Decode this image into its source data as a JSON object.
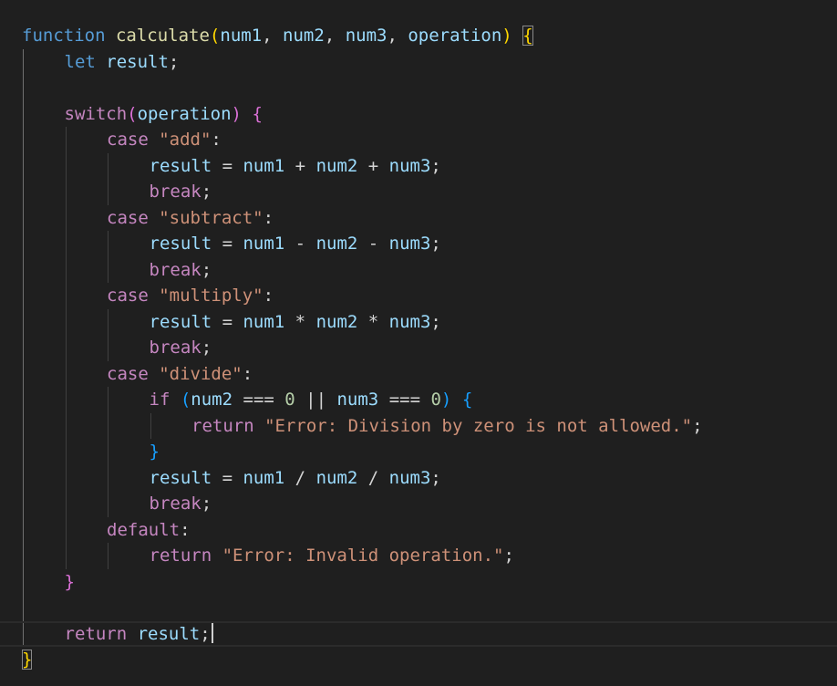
{
  "editor": {
    "language": "javascript",
    "current_line": 24,
    "colors": {
      "background": "#1f1f1f",
      "keyword_storage": "#569cd6",
      "keyword_control": "#c586c0",
      "function_name": "#dcdcaa",
      "variable": "#9cdcfe",
      "string": "#ce9178",
      "number": "#b5cea8",
      "punctuation": "#d4d4d4",
      "bracket_gold": "#ffd700",
      "bracket_pink": "#da70d6",
      "bracket_blue": "#179fff"
    },
    "lines": [
      {
        "indent": 0,
        "tokens": [
          {
            "t": "function",
            "c": "keyword_storage"
          },
          {
            "t": " ",
            "c": "punctuation"
          },
          {
            "t": "calculate",
            "c": "function_name"
          },
          {
            "t": "(",
            "c": "bracket_gold"
          },
          {
            "t": "num1",
            "c": "variable"
          },
          {
            "t": ", ",
            "c": "punctuation"
          },
          {
            "t": "num2",
            "c": "variable"
          },
          {
            "t": ", ",
            "c": "punctuation"
          },
          {
            "t": "num3",
            "c": "variable"
          },
          {
            "t": ", ",
            "c": "punctuation"
          },
          {
            "t": "operation",
            "c": "variable"
          },
          {
            "t": ")",
            "c": "bracket_gold"
          },
          {
            "t": " ",
            "c": "punctuation"
          },
          {
            "t": "{",
            "c": "bracket_gold",
            "match": true
          }
        ]
      },
      {
        "indent": 1,
        "tokens": [
          {
            "t": "let",
            "c": "keyword_storage"
          },
          {
            "t": " ",
            "c": "punctuation"
          },
          {
            "t": "result",
            "c": "variable"
          },
          {
            "t": ";",
            "c": "punctuation"
          }
        ]
      },
      {
        "indent": 0,
        "tokens": []
      },
      {
        "indent": 1,
        "tokens": [
          {
            "t": "switch",
            "c": "keyword_control"
          },
          {
            "t": "(",
            "c": "bracket_pink"
          },
          {
            "t": "operation",
            "c": "variable"
          },
          {
            "t": ")",
            "c": "bracket_pink"
          },
          {
            "t": " ",
            "c": "punctuation"
          },
          {
            "t": "{",
            "c": "bracket_pink"
          }
        ]
      },
      {
        "indent": 2,
        "tokens": [
          {
            "t": "case",
            "c": "keyword_control"
          },
          {
            "t": " ",
            "c": "punctuation"
          },
          {
            "t": "\"add\"",
            "c": "string"
          },
          {
            "t": ":",
            "c": "punctuation"
          }
        ]
      },
      {
        "indent": 3,
        "tokens": [
          {
            "t": "result",
            "c": "variable"
          },
          {
            "t": " = ",
            "c": "punctuation"
          },
          {
            "t": "num1",
            "c": "variable"
          },
          {
            "t": " + ",
            "c": "punctuation"
          },
          {
            "t": "num2",
            "c": "variable"
          },
          {
            "t": " + ",
            "c": "punctuation"
          },
          {
            "t": "num3",
            "c": "variable"
          },
          {
            "t": ";",
            "c": "punctuation"
          }
        ]
      },
      {
        "indent": 3,
        "tokens": [
          {
            "t": "break",
            "c": "keyword_control"
          },
          {
            "t": ";",
            "c": "punctuation"
          }
        ]
      },
      {
        "indent": 2,
        "tokens": [
          {
            "t": "case",
            "c": "keyword_control"
          },
          {
            "t": " ",
            "c": "punctuation"
          },
          {
            "t": "\"subtract\"",
            "c": "string"
          },
          {
            "t": ":",
            "c": "punctuation"
          }
        ]
      },
      {
        "indent": 3,
        "tokens": [
          {
            "t": "result",
            "c": "variable"
          },
          {
            "t": " = ",
            "c": "punctuation"
          },
          {
            "t": "num1",
            "c": "variable"
          },
          {
            "t": " - ",
            "c": "punctuation"
          },
          {
            "t": "num2",
            "c": "variable"
          },
          {
            "t": " - ",
            "c": "punctuation"
          },
          {
            "t": "num3",
            "c": "variable"
          },
          {
            "t": ";",
            "c": "punctuation"
          }
        ]
      },
      {
        "indent": 3,
        "tokens": [
          {
            "t": "break",
            "c": "keyword_control"
          },
          {
            "t": ";",
            "c": "punctuation"
          }
        ]
      },
      {
        "indent": 2,
        "tokens": [
          {
            "t": "case",
            "c": "keyword_control"
          },
          {
            "t": " ",
            "c": "punctuation"
          },
          {
            "t": "\"multiply\"",
            "c": "string"
          },
          {
            "t": ":",
            "c": "punctuation"
          }
        ]
      },
      {
        "indent": 3,
        "tokens": [
          {
            "t": "result",
            "c": "variable"
          },
          {
            "t": " = ",
            "c": "punctuation"
          },
          {
            "t": "num1",
            "c": "variable"
          },
          {
            "t": " * ",
            "c": "punctuation"
          },
          {
            "t": "num2",
            "c": "variable"
          },
          {
            "t": " * ",
            "c": "punctuation"
          },
          {
            "t": "num3",
            "c": "variable"
          },
          {
            "t": ";",
            "c": "punctuation"
          }
        ]
      },
      {
        "indent": 3,
        "tokens": [
          {
            "t": "break",
            "c": "keyword_control"
          },
          {
            "t": ";",
            "c": "punctuation"
          }
        ]
      },
      {
        "indent": 2,
        "tokens": [
          {
            "t": "case",
            "c": "keyword_control"
          },
          {
            "t": " ",
            "c": "punctuation"
          },
          {
            "t": "\"divide\"",
            "c": "string"
          },
          {
            "t": ":",
            "c": "punctuation"
          }
        ]
      },
      {
        "indent": 3,
        "tokens": [
          {
            "t": "if",
            "c": "keyword_control"
          },
          {
            "t": " ",
            "c": "punctuation"
          },
          {
            "t": "(",
            "c": "bracket_blue"
          },
          {
            "t": "num2",
            "c": "variable"
          },
          {
            "t": " === ",
            "c": "punctuation"
          },
          {
            "t": "0",
            "c": "number"
          },
          {
            "t": " || ",
            "c": "punctuation"
          },
          {
            "t": "num3",
            "c": "variable"
          },
          {
            "t": " === ",
            "c": "punctuation"
          },
          {
            "t": "0",
            "c": "number"
          },
          {
            "t": ")",
            "c": "bracket_blue"
          },
          {
            "t": " ",
            "c": "punctuation"
          },
          {
            "t": "{",
            "c": "bracket_blue"
          }
        ]
      },
      {
        "indent": 4,
        "tokens": [
          {
            "t": "return",
            "c": "keyword_control"
          },
          {
            "t": " ",
            "c": "punctuation"
          },
          {
            "t": "\"Error: Division by zero is not allowed.\"",
            "c": "string"
          },
          {
            "t": ";",
            "c": "punctuation"
          }
        ]
      },
      {
        "indent": 3,
        "tokens": [
          {
            "t": "}",
            "c": "bracket_blue"
          }
        ]
      },
      {
        "indent": 3,
        "tokens": [
          {
            "t": "result",
            "c": "variable"
          },
          {
            "t": " = ",
            "c": "punctuation"
          },
          {
            "t": "num1",
            "c": "variable"
          },
          {
            "t": " / ",
            "c": "punctuation"
          },
          {
            "t": "num2",
            "c": "variable"
          },
          {
            "t": " / ",
            "c": "punctuation"
          },
          {
            "t": "num3",
            "c": "variable"
          },
          {
            "t": ";",
            "c": "punctuation"
          }
        ]
      },
      {
        "indent": 3,
        "tokens": [
          {
            "t": "break",
            "c": "keyword_control"
          },
          {
            "t": ";",
            "c": "punctuation"
          }
        ]
      },
      {
        "indent": 2,
        "tokens": [
          {
            "t": "default",
            "c": "keyword_control"
          },
          {
            "t": ":",
            "c": "punctuation"
          }
        ]
      },
      {
        "indent": 3,
        "tokens": [
          {
            "t": "return",
            "c": "keyword_control"
          },
          {
            "t": " ",
            "c": "punctuation"
          },
          {
            "t": "\"Error: Invalid operation.\"",
            "c": "string"
          },
          {
            "t": ";",
            "c": "punctuation"
          }
        ]
      },
      {
        "indent": 1,
        "tokens": [
          {
            "t": "}",
            "c": "bracket_pink"
          }
        ]
      },
      {
        "indent": 0,
        "tokens": []
      },
      {
        "indent": 1,
        "tokens": [
          {
            "t": "return",
            "c": "keyword_control"
          },
          {
            "t": " ",
            "c": "punctuation"
          },
          {
            "t": "result",
            "c": "variable"
          },
          {
            "t": ";",
            "c": "punctuation"
          }
        ]
      },
      {
        "indent": 0,
        "tokens": [
          {
            "t": "}",
            "c": "bracket_gold",
            "match": true
          }
        ]
      }
    ]
  }
}
